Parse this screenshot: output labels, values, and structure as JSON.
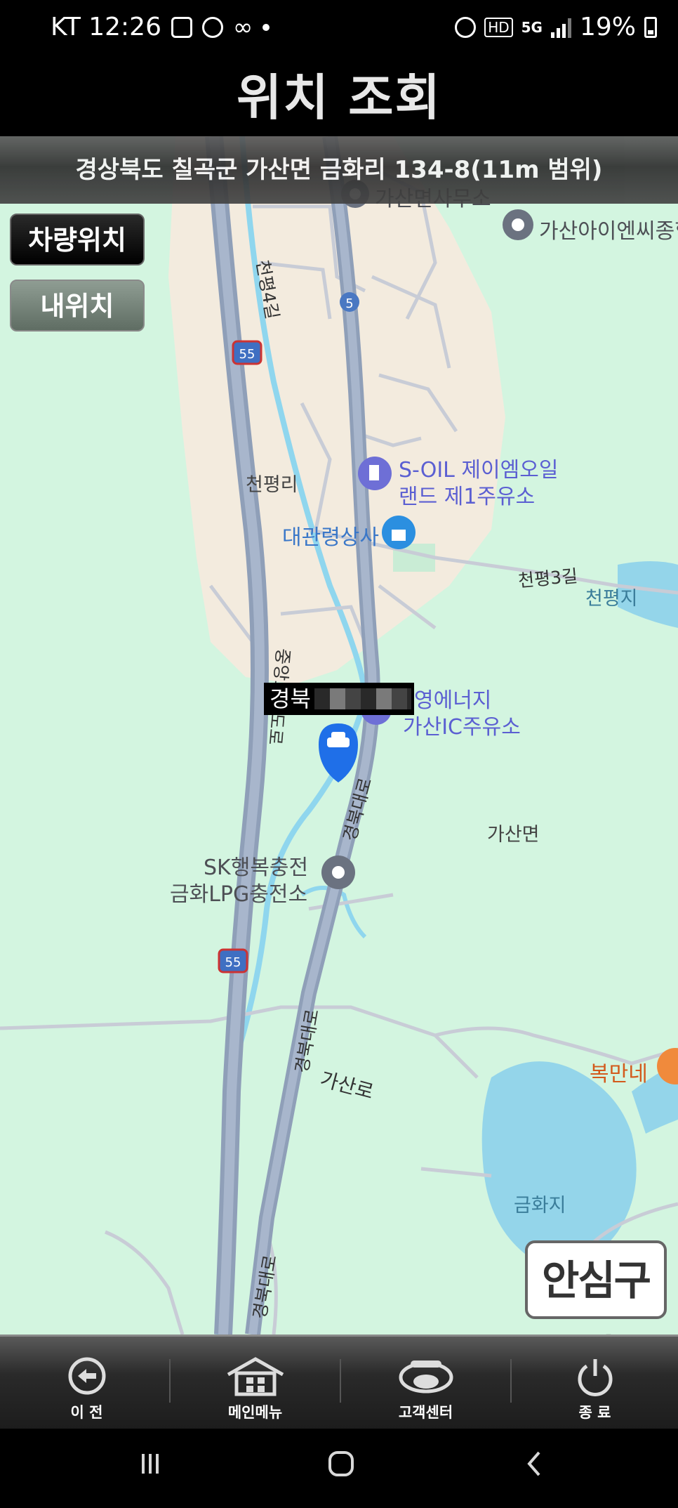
{
  "status": {
    "carrier_time": "KT 12:26",
    "battery": "19%",
    "network": "5G"
  },
  "title": "위치 조회",
  "address": "경상북도 칠곡군 가산면 금화리 134-8(11m 범위)",
  "buttons": {
    "vehicle_location": "차량위치",
    "my_location": "내위치",
    "safe_zone": "안심구역"
  },
  "vehicle_label": "경북",
  "map": {
    "pois": {
      "gasan_office": "가산면사무소",
      "gasan_ienc": "가산아이엔씨종합",
      "soil_line1": "S-OIL 제이엠오일",
      "soil_line2": "랜드 제1주유소",
      "daegwan": "대관령상사",
      "energy_line1": "영에너지",
      "energy_line2": "가산IC주유소",
      "sk_line1": "SK행복충전",
      "sk_line2": "금화LPG충전소",
      "bokmanne": "복만네"
    },
    "places": {
      "cheonpyeongri": "천평리",
      "gasanmyeon": "가산면",
      "cheonpyeongji": "천평지",
      "geumhwaji": "금화지"
    },
    "roads": {
      "cheonpyeong4": "천평4길",
      "cheonpyeong3": "천평3길",
      "jungang_exp": "중앙고속도로",
      "gyeongbuk_daero_1": "경북대로",
      "gyeongbuk_daero_2": "경북대로",
      "gyeongbuk_daero_3": "경북대로",
      "gasanro": "가산로",
      "route5": "5",
      "route55_a": "55",
      "route55_b": "55"
    }
  },
  "bottom_nav": [
    {
      "label": "이 전",
      "icon": "back-arrow-icon"
    },
    {
      "label": "메인메뉴",
      "icon": "home-icon"
    },
    {
      "label": "고객센터",
      "icon": "headset-icon"
    },
    {
      "label": "종 료",
      "icon": "power-icon"
    }
  ],
  "system_nav": [
    "recents",
    "home",
    "back"
  ]
}
